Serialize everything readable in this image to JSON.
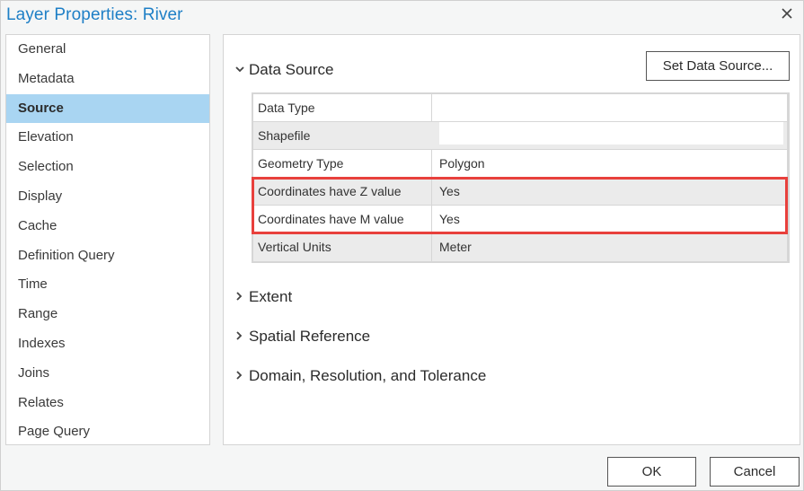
{
  "window": {
    "title": "Layer Properties: River",
    "close_icon": "close-icon"
  },
  "sidebar": {
    "items": [
      {
        "label": "General",
        "active": false
      },
      {
        "label": "Metadata",
        "active": false
      },
      {
        "label": "Source",
        "active": true
      },
      {
        "label": "Elevation",
        "active": false
      },
      {
        "label": "Selection",
        "active": false
      },
      {
        "label": "Display",
        "active": false
      },
      {
        "label": "Cache",
        "active": false
      },
      {
        "label": "Definition Query",
        "active": false
      },
      {
        "label": "Time",
        "active": false
      },
      {
        "label": "Range",
        "active": false
      },
      {
        "label": "Indexes",
        "active": false
      },
      {
        "label": "Joins",
        "active": false
      },
      {
        "label": "Relates",
        "active": false
      },
      {
        "label": "Page Query",
        "active": false
      }
    ]
  },
  "main": {
    "data_source": {
      "label": "Data Source",
      "expanded": true,
      "set_button": "Set Data Source...",
      "rows": [
        {
          "key": "Data Type",
          "value": ""
        },
        {
          "key": "Shapefile",
          "value": ""
        },
        {
          "key": "Geometry Type",
          "value": "Polygon"
        },
        {
          "key": "Coordinates have Z value",
          "value": "Yes"
        },
        {
          "key": "Coordinates have M value",
          "value": "Yes"
        },
        {
          "key": "Vertical Units",
          "value": "Meter"
        }
      ]
    },
    "sections": [
      {
        "label": "Extent",
        "expanded": false
      },
      {
        "label": "Spatial Reference",
        "expanded": false
      },
      {
        "label": "Domain, Resolution, and Tolerance",
        "expanded": false
      }
    ],
    "highlight_color": "#e8403c"
  },
  "footer": {
    "ok": "OK",
    "cancel": "Cancel"
  },
  "colors": {
    "title": "#1e7fc6",
    "selected": "#a9d5f2"
  }
}
